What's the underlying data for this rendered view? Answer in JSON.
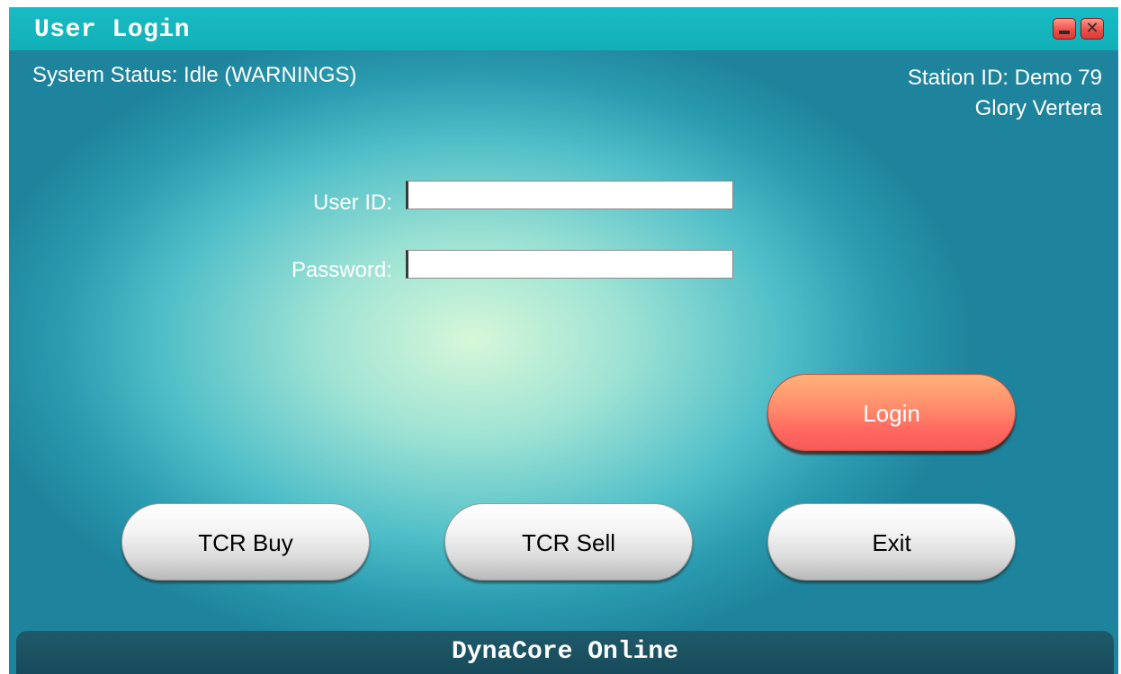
{
  "window": {
    "title": "User Login",
    "controls": {
      "minimize_icon": "minimize-icon",
      "close_icon": "close-icon",
      "close_glyph": "✕"
    }
  },
  "header": {
    "system_status": "System Status: Idle (WARNINGS)",
    "station_id": "Station ID: Demo 79",
    "station_name": "Glory Vertera"
  },
  "form": {
    "user_id_label": "User ID:",
    "user_id_value": "",
    "password_label": "Password:",
    "password_value": ""
  },
  "buttons": {
    "login": "Login",
    "tcr_buy": "TCR Buy",
    "tcr_sell": "TCR Sell",
    "exit": "Exit"
  },
  "footer": {
    "text": "DynaCore Online"
  },
  "colors": {
    "titlebar": "#18bcc4",
    "login_button": "#ff7a64",
    "footer": "#1f5a6a"
  }
}
